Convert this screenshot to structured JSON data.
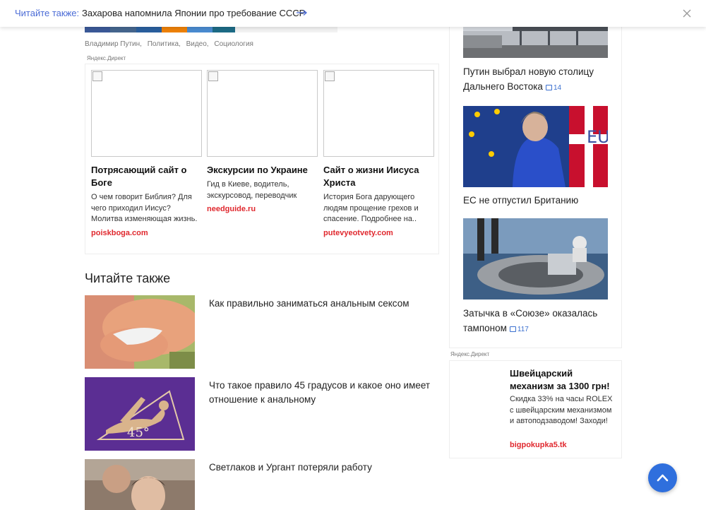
{
  "sticky_bar": {
    "label": "Читайте также:",
    "headline": "Захарова напомнила Японии про требование СССР"
  },
  "share_colors": [
    "#3b5998",
    "#45668e",
    "#2a5f9e",
    "#ee8208",
    "#4a8bd0",
    "#1d6b86"
  ],
  "tags": [
    "Владимир Путин,",
    "Политика,",
    "Видео,",
    "Социология"
  ],
  "yandex_label": "Яндекс.Директ",
  "ads": [
    {
      "title": "Потрясающий сайт о Боге",
      "desc": "О чем говорит Библия? Для чего приходил Иисус? Молитва изменяющая жизнь.",
      "domain": "poiskboga.com"
    },
    {
      "title": "Экскурсии по Украине",
      "desc": "Гид в Киеве, водитель, экскурсовод, переводчик",
      "domain": "needguide.ru"
    },
    {
      "title": "Сайт о жизни Иисуса Христа",
      "desc": "История Бога дарующего людям прощение грехов и спасение. Подробнее на..",
      "domain": "putevyeotvety.com"
    }
  ],
  "read_also": {
    "title": "Читайте также",
    "items": [
      "Как правильно заниматься анальным сексом",
      "Что такое правило 45 градусов и какое оно имеет отношение к анальному",
      "Светлаков и Ургант потеряли работу"
    ],
    "angle_label": "45°"
  },
  "sidebar": {
    "cards": [
      {
        "text": "Путин выбрал новую столицу Дальнего Востока",
        "comments": "14"
      },
      {
        "text": "ЕС не отпустил Британию",
        "comments": ""
      },
      {
        "text": "Затычка в «Союзе» оказалась тампоном",
        "comments": "117"
      }
    ],
    "flag_text": "EU",
    "ad": {
      "title": "Швейцарский механизм за 1300 грн!",
      "desc": "Скидка 33% на часы ROLEX с швейцарским механизмом и автоподзаводом! Заходи!",
      "domain": "bigpokupka5.tk"
    }
  },
  "colors": {
    "accent": "#4a6bd6",
    "ad_domain": "#e0282e",
    "comment": "#3a6fcf",
    "fab": "#2f6fdd"
  }
}
